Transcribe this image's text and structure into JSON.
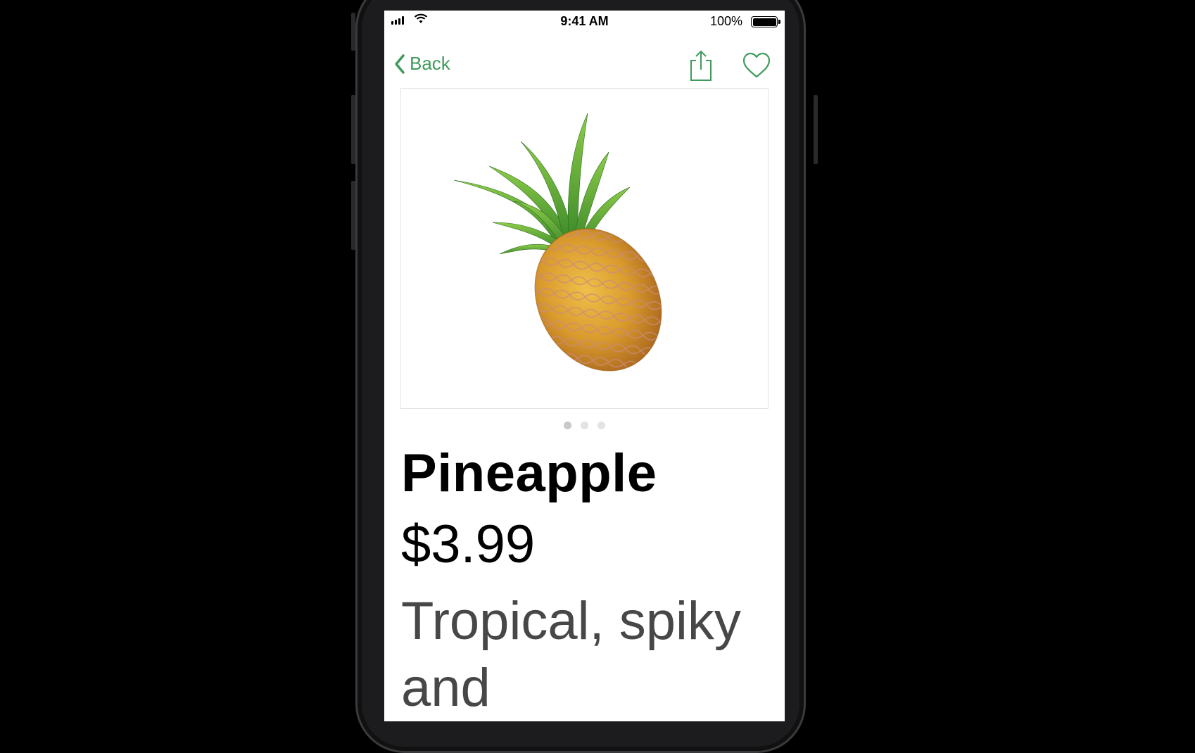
{
  "status_bar": {
    "time": "9:41 AM",
    "battery_percent": "100%",
    "signal_bars": 4,
    "battery_level": 1.0
  },
  "nav": {
    "back_label": "Back",
    "share_icon": "share-icon",
    "favorite_icon": "heart-icon"
  },
  "product": {
    "image": "pineapple-image",
    "name": "Pineapple",
    "price": "$3.99",
    "description": "Tropical, spiky and"
  },
  "carousel": {
    "page_count": 3,
    "current_page": 1
  },
  "colors": {
    "accent": "#3f9b5c",
    "description_text": "#474747"
  }
}
